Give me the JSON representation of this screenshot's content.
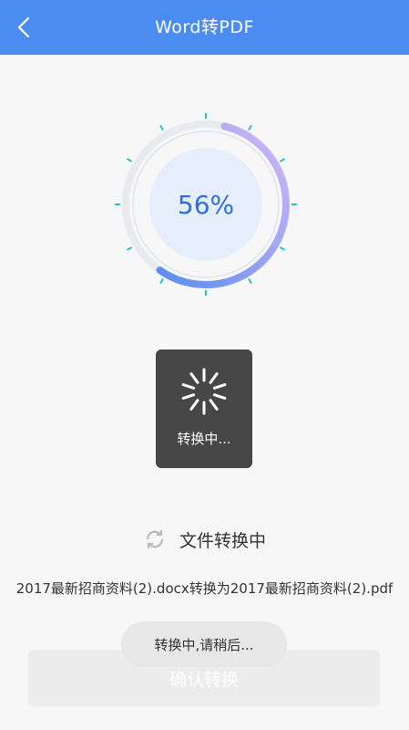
{
  "header": {
    "title": "Word转PDF",
    "back_icon": "chevron-left-icon"
  },
  "progress": {
    "percent_text": "56%",
    "value": 0.56
  },
  "loading_dialog": {
    "label": "转换中..."
  },
  "status": {
    "icon": "refresh-icon",
    "label": "文件转换中"
  },
  "file": {
    "description": "2017最新招商资料(2).docx转换为2017最新招商资料(2).pdf"
  },
  "confirm_button": {
    "label": "确认转换"
  },
  "toast": {
    "message": "转换中,请稍后..."
  },
  "colors": {
    "header": "#4b8cf0",
    "accent": "#2c6fd8",
    "tick": "#27c3c3",
    "arc_start": "#5b8ef0",
    "arc_end": "#d6b8f5"
  }
}
